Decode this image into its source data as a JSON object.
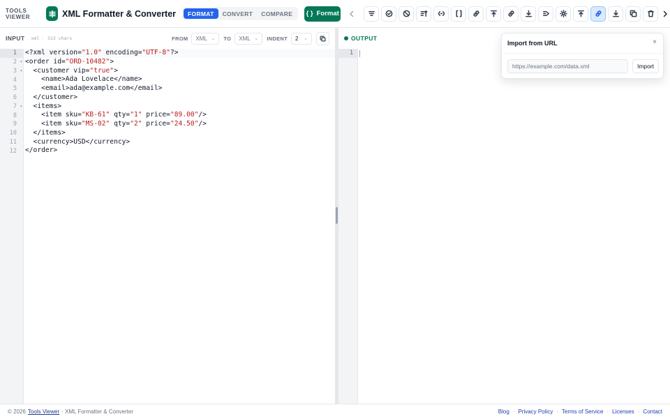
{
  "brand": "TOOLS VIEWER",
  "app": {
    "title": "XML Formatter & Converter",
    "logo_icon": "equals-icon"
  },
  "modes": [
    {
      "label": "FORMAT",
      "active": true
    },
    {
      "label": "CONVERT",
      "active": false
    },
    {
      "label": "COMPARE",
      "active": false
    }
  ],
  "format_button": {
    "icon": "{ }",
    "label": "Format"
  },
  "toolbar_icons": [
    "minify-icon",
    "validate-icon",
    "clear-icon",
    "sort-icon",
    "collapse-icon",
    "brackets-icon",
    "link-icon",
    "upload-icon",
    "share-link-icon",
    "download-icon",
    "send-icon",
    "theme-icon",
    "export-icon",
    "import-url-icon",
    "save-icon",
    "copy-icon",
    "delete-icon"
  ],
  "input_panel": {
    "label": "INPUT",
    "meta": "xml · 313 chars",
    "from_label": "FROM",
    "from_value": "XML",
    "to_label": "TO",
    "to_value": "XML",
    "indent_label": "INDENT",
    "indent_value": "2"
  },
  "code_lines": [
    "<?xml version=\"1.0\" encoding=\"UTF-8\"?>",
    "<order id=\"ORD-10482\">",
    "  <customer vip=\"true\">",
    "    <name>Ada Lovelace</name>",
    "    <email>ada@example.com</email>",
    "  </customer>",
    "  <items>",
    "    <item sku=\"KB-61\" qty=\"1\" price=\"89.00\"/>",
    "    <item sku=\"MS-02\" qty=\"2\" price=\"24.50\"/>",
    "  </items>",
    "  <currency>USD</currency>",
    "</order>"
  ],
  "line_numbers": [
    "1",
    "2",
    "3",
    "4",
    "5",
    "6",
    "7",
    "8",
    "9",
    "10",
    "11",
    "12"
  ],
  "fold_lines": [
    1,
    2,
    6
  ],
  "output_panel": {
    "label": "OUTPUT",
    "line_numbers": [
      "1"
    ]
  },
  "import_popover": {
    "title": "Import from URL",
    "close": "×",
    "placeholder": "https://example.com/data.xml",
    "button": "Import"
  },
  "footer": {
    "copyright": "© 2026",
    "site_link": "Tools Viewer",
    "suffix": "· XML Formatter & Converter",
    "links": [
      "Blog",
      "Privacy Policy",
      "Terms of Service",
      "Licenses",
      "Contact"
    ]
  },
  "colors": {
    "accent_green": "#047857",
    "accent_blue": "#2563eb",
    "string_red": "#b91c1c"
  }
}
